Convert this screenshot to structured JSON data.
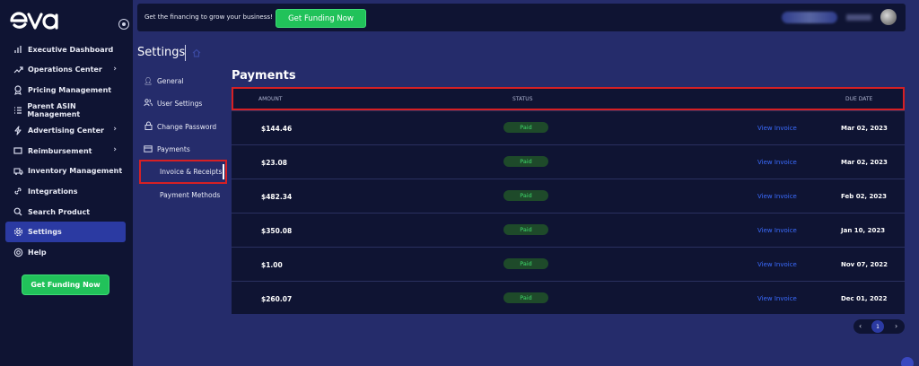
{
  "sidebar": {
    "brand": "eva",
    "items": [
      {
        "label": "Executive Dashboard",
        "icon": "bar-chart-icon",
        "has_submenu": false
      },
      {
        "label": "Operations Center",
        "icon": "trend-up-icon",
        "has_submenu": true
      },
      {
        "label": "Pricing Management",
        "icon": "award-icon",
        "has_submenu": false
      },
      {
        "label": "Parent ASIN Management",
        "icon": "list-icon",
        "has_submenu": false
      },
      {
        "label": "Advertising Center",
        "icon": "lightning-icon",
        "has_submenu": true
      },
      {
        "label": "Reimbursement",
        "icon": "receipt-icon",
        "has_submenu": true
      },
      {
        "label": "Inventory Management",
        "icon": "truck-icon",
        "has_submenu": true
      },
      {
        "label": "Integrations",
        "icon": "link-icon",
        "has_submenu": false
      },
      {
        "label": "Search Product",
        "icon": "search-icon",
        "has_submenu": false
      },
      {
        "label": "Settings",
        "icon": "gear-icon",
        "has_submenu": false,
        "active": true
      },
      {
        "label": "Help",
        "icon": "lifebuoy-icon",
        "has_submenu": false
      }
    ],
    "cta": "Get Funding Now"
  },
  "topbar": {
    "promo_text": "Get the financing to grow your business!",
    "cta": "Get Funding Now"
  },
  "settings": {
    "title": "Settings",
    "menu": [
      {
        "label": "General",
        "icon": "user-icon",
        "child": false
      },
      {
        "label": "User Settings",
        "icon": "users-icon",
        "child": false
      },
      {
        "label": "Change Password",
        "icon": "lock-icon",
        "child": false
      },
      {
        "label": "Payments",
        "icon": "card-icon",
        "child": false
      },
      {
        "label": "Invoice & Receipts",
        "icon": "",
        "child": true,
        "active": true
      },
      {
        "label": "Payment Methods",
        "icon": "",
        "child": true
      }
    ]
  },
  "payments": {
    "title": "Payments",
    "headers": {
      "amount": "AMOUNT",
      "status": "STATUS",
      "due_date": "DUE DATE"
    },
    "rows": [
      {
        "amount": "$144.46",
        "status": "Paid",
        "link": "View Invoice",
        "due_date": "Mar 02, 2023"
      },
      {
        "amount": "$23.08",
        "status": "Paid",
        "link": "View Invoice",
        "due_date": "Mar 02, 2023"
      },
      {
        "amount": "$482.34",
        "status": "Paid",
        "link": "View Invoice",
        "due_date": "Feb 02, 2023"
      },
      {
        "amount": "$350.08",
        "status": "Paid",
        "link": "View Invoice",
        "due_date": "Jan 10, 2023"
      },
      {
        "amount": "$1.00",
        "status": "Paid",
        "link": "View Invoice",
        "due_date": "Nov 07, 2022"
      },
      {
        "amount": "$260.07",
        "status": "Paid",
        "link": "View Invoice",
        "due_date": "Dec 01, 2022"
      }
    ]
  },
  "pagination": {
    "prev": "‹",
    "current": "1",
    "next": "›"
  },
  "colors": {
    "background": "#252c6b",
    "panel": "#0f1433",
    "accent_green": "#21c25a",
    "active_nav": "#2b3aa2",
    "link_blue": "#3b6cff",
    "highlight_red": "#d62024"
  }
}
